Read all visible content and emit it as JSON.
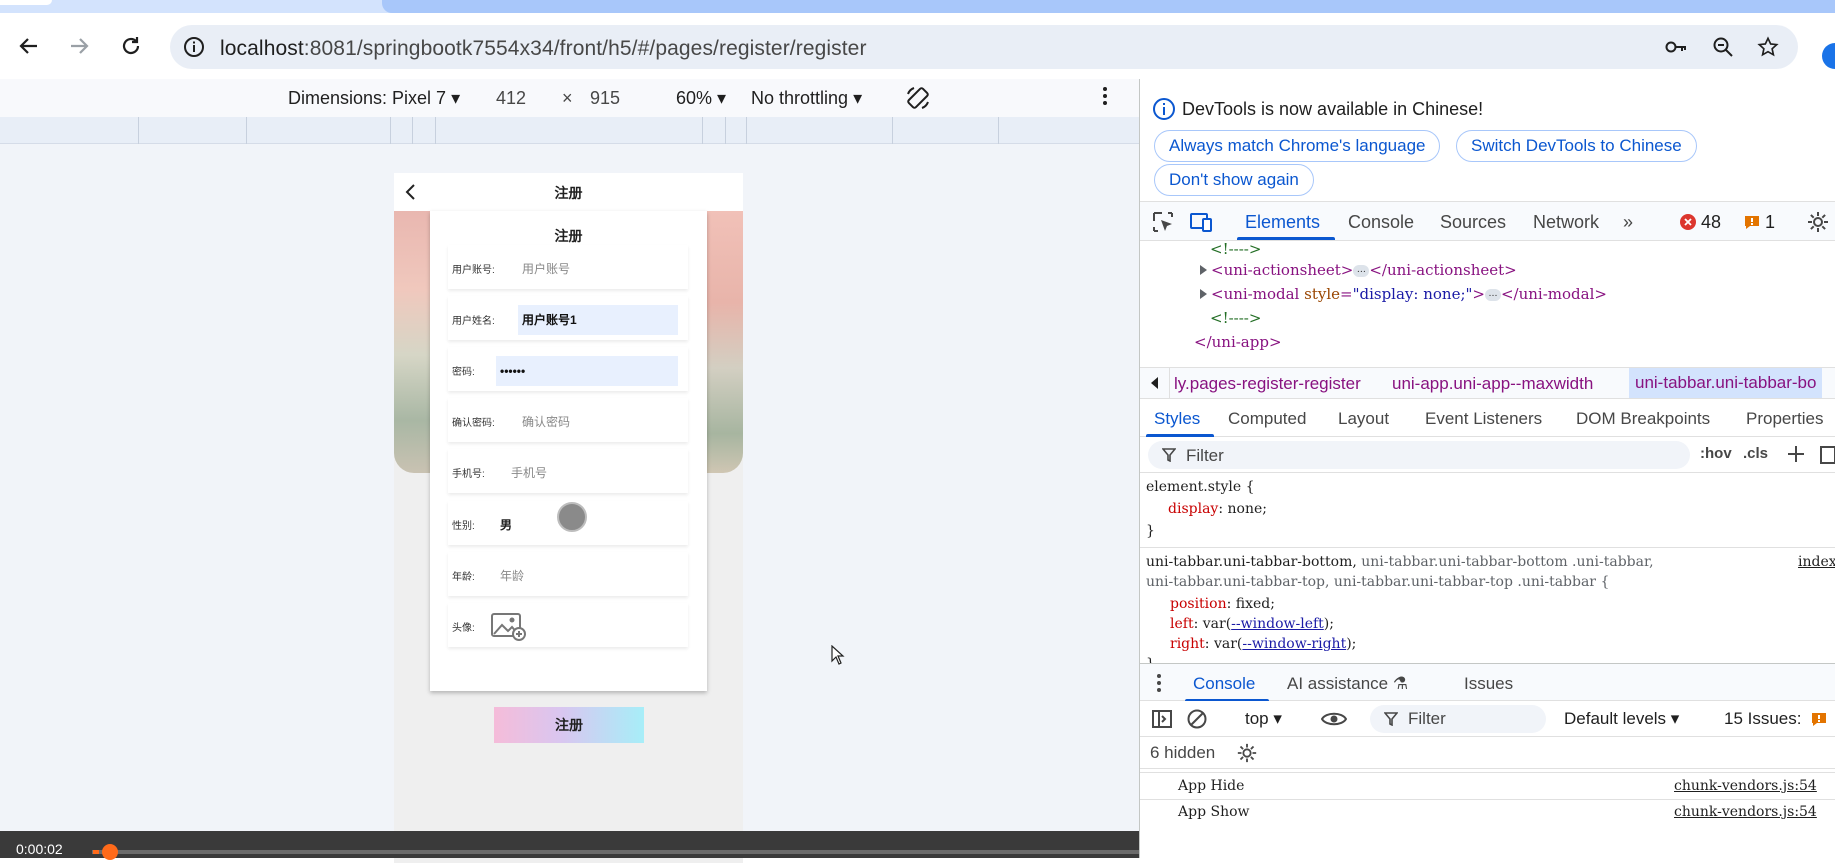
{
  "browser": {
    "url_host": "localhost",
    "url_path": ":8081/springbootk7554x34/front/h5/#/pages/register/register",
    "icons": [
      "back-icon",
      "forward-icon",
      "reload-icon",
      "site-info-icon",
      "key-icon",
      "zoom-icon",
      "star-icon"
    ]
  },
  "device_toolbar": {
    "dimensions_label": "Dimensions: Pixel 7",
    "width": "412",
    "times": "×",
    "height": "915",
    "zoom": "60%",
    "throttling": "No throttling"
  },
  "phone": {
    "nav_title": "注册",
    "card_title": "注册",
    "fields": [
      {
        "label": "用户账号:",
        "value": "用户账号",
        "placeholder": true
      },
      {
        "label": "用户姓名:",
        "value": "用户账号1",
        "placeholder": false
      },
      {
        "label": "密码:",
        "value": "••••••",
        "placeholder": false
      },
      {
        "label": "确认密码:",
        "value": "确认密码",
        "placeholder": true
      },
      {
        "label": "手机号:",
        "value": "手机号",
        "placeholder": true
      },
      {
        "label": "性别:",
        "value": "男",
        "placeholder": false
      },
      {
        "label": "年龄:",
        "value": "年龄",
        "placeholder": true
      },
      {
        "label": "头像:",
        "value": "",
        "placeholder": false
      }
    ],
    "submit_label": "注册"
  },
  "video": {
    "time": "0:00:02"
  },
  "devtools": {
    "banner_message": "DevTools is now available in Chinese!",
    "banner_buttons": [
      "Always match Chrome's language",
      "Switch DevTools to Chinese",
      "Don't show again"
    ],
    "tabs": [
      "Elements",
      "Console",
      "Sources",
      "Network"
    ],
    "active_tab": "Elements",
    "error_count": "48",
    "warning_count": "1",
    "dom_lines": {
      "comment1": "<!---->",
      "actionsheet_open": "<uni-actionsheet>",
      "actionsheet_close": "</uni-actionsheet>",
      "modal_open": "<uni-modal ",
      "modal_attr": "style",
      "modal_attr_value": "\"display: none;\"",
      "modal_close": "</uni-modal>",
      "comment2": "<!---->",
      "app_close": "</uni-app>"
    },
    "breadcrumbs": [
      "ly.pages-register-register",
      "uni-app.uni-app--maxwidth",
      "uni-tabbar.uni-tabbar-bo"
    ],
    "subtabs": [
      "Styles",
      "Computed",
      "Layout",
      "Event Listeners",
      "DOM Breakpoints",
      "Properties"
    ],
    "filter_placeholder": "Filter",
    "hov_label": ":hov",
    "cls_label": ".cls",
    "styles": {
      "element_style": "element.style {",
      "display_prop": "display",
      "display_val": "none;",
      "close1": "}",
      "rule_selector_1a": "uni-tabbar.uni-tabbar-bottom,",
      "rule_selector_1b": " uni-tabbar.uni-tabbar-bottom .uni-tabbar,",
      "rule_selector_2": "uni-tabbar.uni-tabbar-top, uni-tabbar.uni-tabbar-top .uni-tabbar {",
      "source_link": "index",
      "position_prop": "position",
      "position_val": "fixed;",
      "left_prop": "left",
      "left_val_pre": "var(",
      "left_var": "--window-left",
      "left_val_post": ");",
      "right_prop": "right",
      "right_val_pre": "var(",
      "right_var": "--window-right",
      "right_val_post": ");",
      "close2": "}"
    },
    "drawer_tabs": [
      "Console",
      "AI assistance",
      "Issues"
    ],
    "console_context": "top",
    "console_filter": "Filter",
    "levels": "Default levels",
    "issues_label": "15 Issues:",
    "hidden_label": "6 hidden",
    "logs": [
      {
        "msg": "App Hide",
        "src": "chunk-vendors.js:54"
      },
      {
        "msg": "App Show",
        "src": "chunk-vendors.js:54"
      }
    ]
  }
}
